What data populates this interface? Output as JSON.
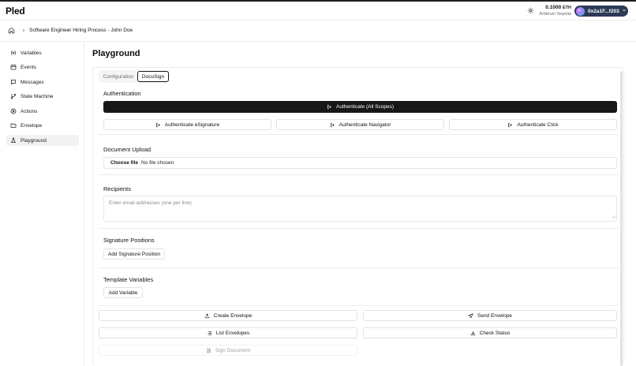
{
  "app": {
    "brand": "Pled"
  },
  "header": {
    "balance_amount": "0.1000",
    "balance_unit": "ETH",
    "network": "Arbitrum Sepolia",
    "wallet_address": "0x2a1F...f203"
  },
  "breadcrumb": {
    "label": "Software Engineer Hiring Process - John Doe"
  },
  "sidebar": {
    "items": [
      {
        "label": "Variables",
        "icon": "variable-icon"
      },
      {
        "label": "Events",
        "icon": "calendar-icon"
      },
      {
        "label": "Messages",
        "icon": "message-icon"
      },
      {
        "label": "State Machine",
        "icon": "git-branch-icon"
      },
      {
        "label": "Actions",
        "icon": "play-circle-icon"
      },
      {
        "label": "Envelope",
        "icon": "folder-icon"
      },
      {
        "label": "Playground",
        "icon": "flask-icon",
        "active": true
      }
    ]
  },
  "main": {
    "title": "Playground",
    "tabs": [
      {
        "label": "Configuration",
        "active": false
      },
      {
        "label": "DocuSign",
        "active": true
      }
    ],
    "auth": {
      "title": "Authentication",
      "all_scopes": "Authenticate (All Scopes)",
      "esignature": "Authenticate eSignature",
      "navigator": "Authenticate Navigator",
      "click": "Authenticate Click"
    },
    "upload": {
      "title": "Document Upload",
      "choose_label": "Choose file",
      "status": "No file chosen"
    },
    "recipients": {
      "title": "Recipients",
      "placeholder": "Enter email addresses (one per line)"
    },
    "signature": {
      "title": "Signature Positions",
      "add_label": "Add Signature Position"
    },
    "template": {
      "title": "Template Variables",
      "add_label": "Add Variable"
    },
    "actions": {
      "create": "Create Envelope",
      "send": "Send Envelope",
      "list": "List Envelopes",
      "check": "Check Status",
      "sign": "Sign Document"
    }
  },
  "colors": {
    "primary_button": "#171717",
    "wallet_bg": "#2b3a55",
    "border": "#ececec"
  }
}
